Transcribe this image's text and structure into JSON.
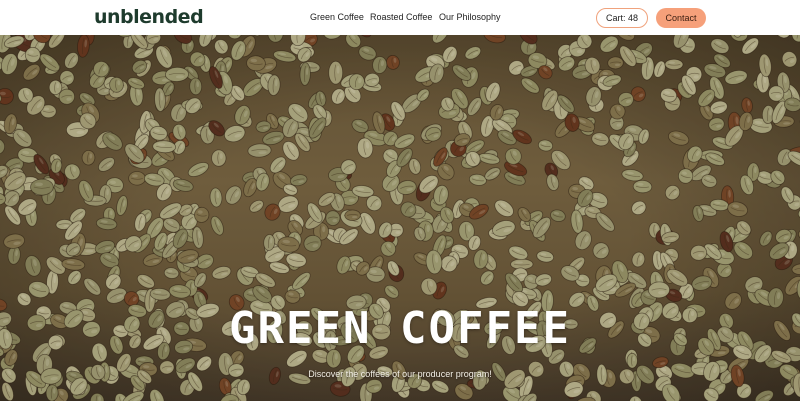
{
  "header": {
    "logo": "unblended",
    "nav": [
      {
        "label": "Green Coffee"
      },
      {
        "label": "Roasted Coffee"
      },
      {
        "label": "Our Philosophy"
      }
    ],
    "cart_label": "Cart: 48",
    "contact_label": "Contact"
  },
  "hero": {
    "image_icon": "green-coffee-beans-image",
    "title": "GREEN COFFEE",
    "subtitle": "Discover the coffees of our producer program!"
  },
  "colors": {
    "brand_dark_green": "#1e3b2d",
    "accent_orange": "#f6a07a",
    "cart_border": "#f0a27c"
  }
}
